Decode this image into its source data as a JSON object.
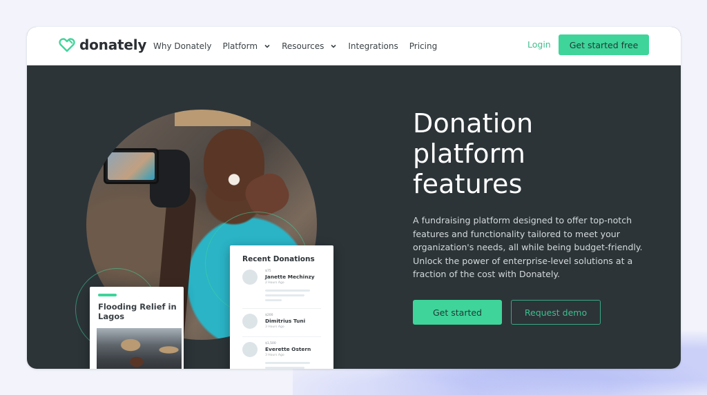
{
  "nav": {
    "brand": "donately",
    "items": [
      {
        "label": "Why Donately",
        "has_dropdown": false
      },
      {
        "label": "Platform",
        "has_dropdown": true
      },
      {
        "label": "Resources",
        "has_dropdown": true
      },
      {
        "label": "Integrations",
        "has_dropdown": false
      },
      {
        "label": "Pricing",
        "has_dropdown": false
      }
    ],
    "login_label": "Login",
    "cta_label": "Get started free"
  },
  "hero": {
    "title_lines": [
      "Donation",
      "platform",
      "features"
    ],
    "description": "A fundraising platform designed to offer top-notch features and functionality tailored to meet your organization's needs, all while being budget-friendly. Unlock the power of enterprise-level solutions at a fraction of the cost with Donately.",
    "primary_button": "Get started",
    "secondary_button": "Request demo"
  },
  "recent_donations": {
    "title": "Recent Donations",
    "items": [
      {
        "amount": "$75",
        "name": "Janette Mechinzy",
        "time": "2 Hours Ago"
      },
      {
        "amount": "$200",
        "name": "Dimitrius Tuni",
        "time": "3 Hours Ago"
      },
      {
        "amount": "$1,500",
        "name": "Everette Ostern",
        "time": "3 Hours Ago"
      }
    ]
  },
  "campaign_card": {
    "title": "Flooding Relief in Lagos"
  },
  "colors": {
    "brand_green": "#3fd49a",
    "hero_bg": "#2c3438",
    "page_bg": "#f2f3fb"
  }
}
